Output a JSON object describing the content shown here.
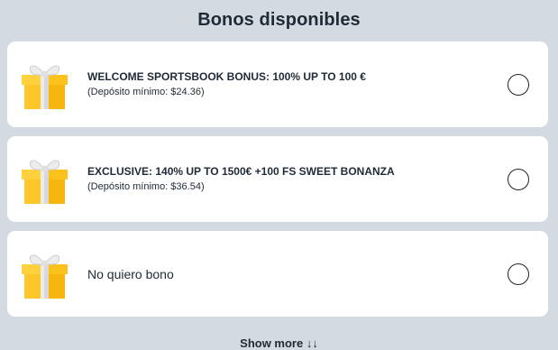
{
  "header": {
    "title": "Bonos disponibles"
  },
  "bonuses": [
    {
      "title": "WELCOME SPORTSBOOK BONUS: 100% UP TO 100 €",
      "subtitle": "(Depósito mínimo: $24.36)",
      "icon": "gift-icon",
      "selected": false
    },
    {
      "title": "EXCLUSIVE: 140% UP TO 1500€ +100 FS SWEET BONANZA",
      "subtitle": "(Depósito mínimo: $36.54)",
      "icon": "gift-icon",
      "selected": false
    },
    {
      "label": "No quiero bono",
      "icon": "gift-icon",
      "selected": false
    }
  ],
  "footer": {
    "show_more_label": "Show more ↓↓"
  },
  "colors": {
    "background": "#d3dae1",
    "card": "#ffffff",
    "text": "#1f2a37",
    "gift_yellow": "#fbc01a",
    "gift_ribbon": "#e9e9e9"
  }
}
